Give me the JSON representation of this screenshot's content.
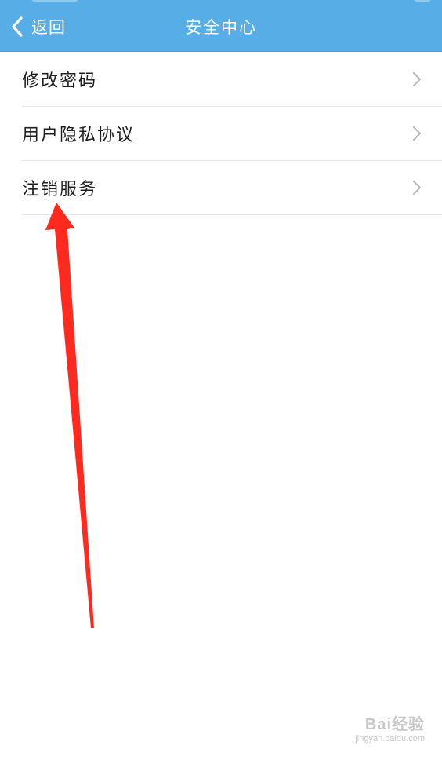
{
  "header": {
    "back_label": "返回",
    "title": "安全中心",
    "background_color": "#57aee6",
    "text_color": "#ffffff",
    "back_icon": "chevron-left-icon"
  },
  "menu": {
    "items": [
      {
        "label": "修改密码",
        "icon": "chevron-right-icon"
      },
      {
        "label": "用户隐私协议",
        "icon": "chevron-right-icon"
      },
      {
        "label": "注销服务",
        "icon": "chevron-right-icon"
      }
    ],
    "divider_color": "#e6e6e6",
    "chevron_color": "#b8b8b8"
  },
  "annotation": {
    "arrow_color": "#ff2a1f",
    "points_to": "注销服务"
  },
  "watermark": {
    "text": "Bai经验",
    "sub": "jingyan.baidu.com"
  }
}
